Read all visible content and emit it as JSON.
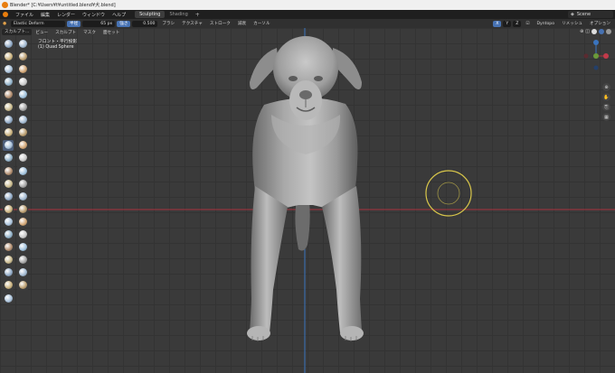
{
  "window": {
    "title": "Blender* [C:¥Users¥t¥untitled.blend¥犬.blend]"
  },
  "menu": {
    "items": [
      "ファイル",
      "編集",
      "レンダー",
      "ウィンドウ",
      "ヘルプ"
    ],
    "workspace_tabs": [
      "Sculpting",
      "Shading"
    ],
    "add_tab_label": "+",
    "scene_label": "Scene"
  },
  "tool_header": {
    "brush_name": "Elastic Deform",
    "radius_label": "半径",
    "radius_value": "65 px",
    "strength_label": "強さ",
    "strength_value": "0.500",
    "brush_menu": "ブラシ",
    "texture_menu": "テクスチャ",
    "stroke_menu": "ストローク",
    "falloff_menu": "減衰",
    "cursor_menu": "カーソル",
    "symmetry_axes": [
      "X",
      "Y",
      "Z"
    ],
    "dyntopo_label": "Dyntopo",
    "remesh_label": "リメッシュ",
    "options_label": "オプション"
  },
  "view_header": {
    "mode": "スカルプト...",
    "items": [
      "ビュー",
      "スカルプト",
      "マスク",
      "面セット"
    ]
  },
  "viewport": {
    "view_name": "フロント・平行投影",
    "object_name": "(1) Quad Sphere"
  },
  "colors": {
    "x_axis": "#a8323e",
    "z_axis": "#3a74bf",
    "brush_cursor": "#d8c64a",
    "active_tool": "#4d5e7a"
  },
  "toolbar_icons": [
    "draw-brush-icon",
    "draw-sharp-brush-icon",
    "clay-brush-icon",
    "clay-strips-brush-icon",
    "clay-thumb-brush-icon",
    "layer-brush-icon",
    "inflate-brush-icon",
    "blob-brush-icon",
    "crease-brush-icon",
    "smooth-brush-icon",
    "flatten-brush-icon",
    "fill-brush-icon",
    "scrape-brush-icon",
    "multiplane-scrape-brush-icon",
    "pinch-brush-icon",
    "grab-brush-icon",
    "elastic-deform-brush-icon",
    "snake-hook-brush-icon",
    "thumb-brush-icon",
    "pose-brush-icon",
    "nudge-brush-icon",
    "rotate-brush-icon",
    "slide-relax-brush-icon",
    "boundary-brush-icon",
    "cloth-brush-icon",
    "simplify-brush-icon",
    "mask-brush-icon",
    "draw-face-sets-brush-icon",
    "box-mask-icon",
    "box-hide-icon",
    "box-face-set-icon",
    "box-trim-icon",
    "line-project-icon",
    "mesh-filter-icon",
    "cloth-filter-icon",
    "color-filter-icon",
    "move-icon",
    "rotate-icon",
    "scale-icon",
    "transform-icon",
    "annotate-icon"
  ]
}
